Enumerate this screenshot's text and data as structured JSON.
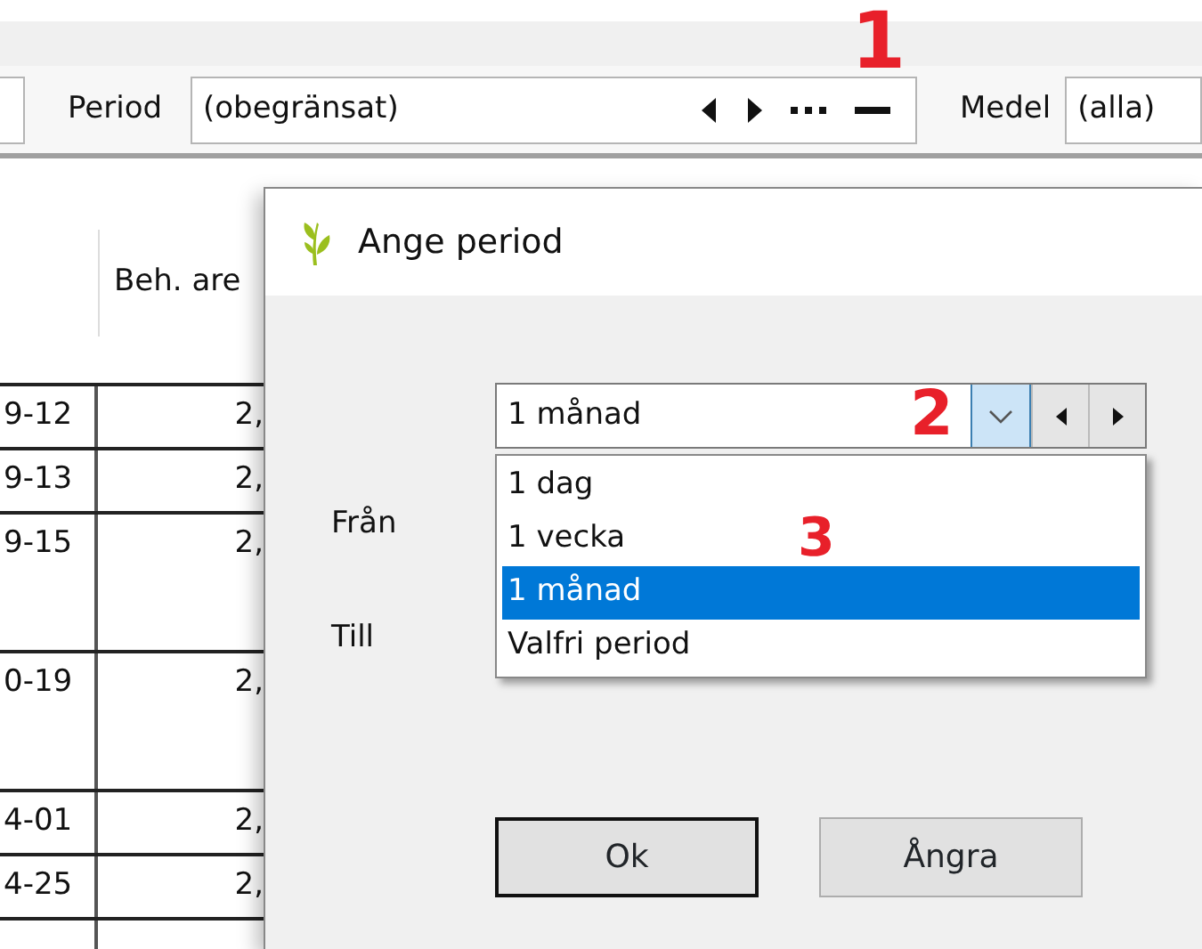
{
  "toolbar": {
    "period_label": "Period",
    "period_value": "(obegränsat)",
    "medel_label": "Medel",
    "medel_value": "(alla)"
  },
  "table": {
    "header": "Beh. are",
    "rows": [
      {
        "column_1": "9-12",
        "column_2": "2,",
        "kind": "single"
      },
      {
        "column_1": "9-13",
        "column_2": "2,",
        "kind": "single"
      },
      {
        "column_1": "9-15",
        "column_2": "2,",
        "kind": "tall"
      },
      {
        "column_1": "0-19",
        "column_2": "2,",
        "kind": "tall"
      },
      {
        "column_1": "4-01",
        "column_2": "2,",
        "kind": "single"
      },
      {
        "column_1": "4-25",
        "column_2": "2,",
        "kind": "single"
      }
    ]
  },
  "dialog": {
    "title": "Ange period",
    "period_select": {
      "value": "1 månad",
      "open": true
    },
    "options": [
      {
        "label": "1 dag",
        "selected": false
      },
      {
        "label": "1 vecka",
        "selected": false
      },
      {
        "label": "1 månad",
        "selected": true
      },
      {
        "label": "Valfri period",
        "selected": false
      }
    ],
    "labels": [
      "Från",
      "Till"
    ],
    "buttons": [
      {
        "label": "Ok",
        "default": true
      },
      {
        "label": "Ångra",
        "default": false
      }
    ]
  },
  "annotations": [
    {
      "label": "1"
    },
    {
      "label": "2"
    },
    {
      "label": "3"
    }
  ]
}
